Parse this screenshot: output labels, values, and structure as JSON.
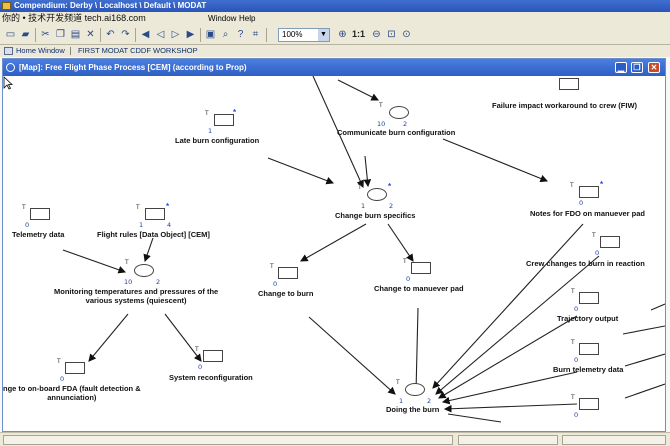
{
  "window": {
    "title": "Compendium: Derby \\ Localhost \\ Default \\ MODAT"
  },
  "menubar": {
    "watermark": "你的 • 技术开发频道 tech.ai168.com",
    "items": [
      "Window",
      "Help"
    ]
  },
  "toolbar": {
    "zoom_value": "100%",
    "one_to_one": "1:1"
  },
  "navbar": {
    "home": "Home Window",
    "crumb": "FIRST MODAT CDDF WORKSHOP"
  },
  "map": {
    "title": "[Map]: Free Flight Phase Process [CEM] (according to Prop)",
    "nodes": {
      "failure": {
        "label": "Failure impact workaround to crew (FIW)"
      },
      "communicate": {
        "label": "Communicate burn configuration",
        "n1": "10",
        "n2": "2"
      },
      "late": {
        "label": "Late burn configuration",
        "n1": "1"
      },
      "change_specifics": {
        "label": "Change burn specifics",
        "n1": "1",
        "n2": "2"
      },
      "notes": {
        "label": "Notes for FDO on manuever pad",
        "n1": "0"
      },
      "telemetry": {
        "label": "Telemetry data",
        "n1": "0"
      },
      "flight_rules": {
        "label": "Flight rules [Data Object] [CEM]",
        "n1": "1",
        "n2": "4"
      },
      "monitoring": {
        "label": "Monitoring temperatures and pressures of the\nvarious systems (quiescent)",
        "n1": "10",
        "n2": "2"
      },
      "change_to_burn": {
        "label": "Change to burn",
        "n1": "0"
      },
      "change_pad": {
        "label": "Change to manuever pad",
        "n1": "0"
      },
      "crew_changes": {
        "label": "Crew changes to burn in reaction",
        "n1": "0"
      },
      "trajectory": {
        "label": "Trajectory output",
        "n1": "0"
      },
      "fault": {
        "label": "nge to on-board FDA (fault detection &\nannunciation)",
        "n1": "0"
      },
      "reconfig": {
        "label": "System reconfiguration",
        "n1": "0"
      },
      "burn_telemetry": {
        "label": "Burn telemetry data",
        "n1": "0"
      },
      "doing": {
        "label": "Doing the burn",
        "n1": "1",
        "n2": "2"
      },
      "bottom_right": {
        "n1": "0"
      }
    }
  },
  "colors": {
    "title_blue": "#2f5fc4",
    "node_number_blue": "#1e3ea0",
    "star_blue": "#2a4ae8"
  }
}
